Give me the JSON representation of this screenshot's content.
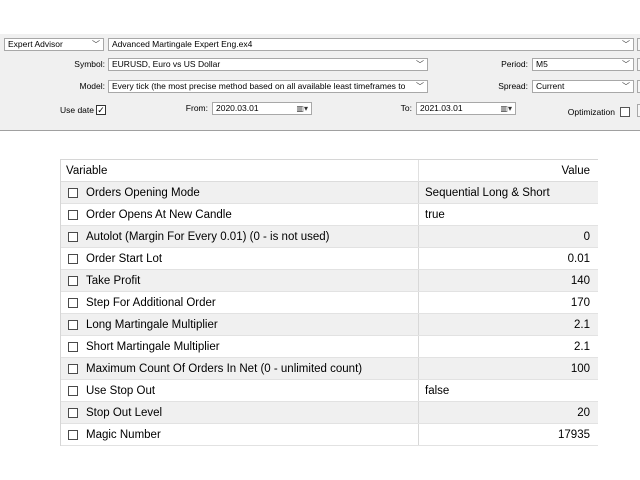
{
  "settings": {
    "expert_label": "Expert Advisor",
    "expert_value": "Advanced Martingale Expert Eng.ex4",
    "symbol_label": "Symbol:",
    "symbol_value": "EURUSD, Euro vs US Dollar",
    "period_label": "Period:",
    "period_value": "M5",
    "model_label": "Model:",
    "model_value": "Every tick (the most precise method based on all available least timeframes to",
    "spread_label": "Spread:",
    "spread_value": "Current",
    "use_date_label": "Use date",
    "use_date_checked": "✓",
    "from_label": "From:",
    "from_value": "2020.03.01",
    "to_label": "To:",
    "to_value": "2021.03.01",
    "optimization_label": "Optimization"
  },
  "table": {
    "header_variable": "Variable",
    "header_value": "Value",
    "rows": [
      {
        "name": "Orders Opening Mode",
        "value": "Sequential Long & Short"
      },
      {
        "name": "Order Opens At New Candle",
        "value": "true"
      },
      {
        "name": "Autolot (Margin For Every 0.01) (0 - is not used)",
        "value": "0"
      },
      {
        "name": "Order Start Lot",
        "value": "0.01"
      },
      {
        "name": "Take Profit",
        "value": "140"
      },
      {
        "name": "Step For Additional Order",
        "value": "170"
      },
      {
        "name": "Long Martingale Multiplier",
        "value": "2.1"
      },
      {
        "name": "Short Martingale Multiplier",
        "value": "2.1"
      },
      {
        "name": "Maximum Count Of Orders In Net (0 - unlimited count)",
        "value": "100"
      },
      {
        "name": "Use Stop Out",
        "value": "false"
      },
      {
        "name": "Stop Out Level",
        "value": "20"
      },
      {
        "name": "Magic Number",
        "value": "17935"
      }
    ]
  }
}
